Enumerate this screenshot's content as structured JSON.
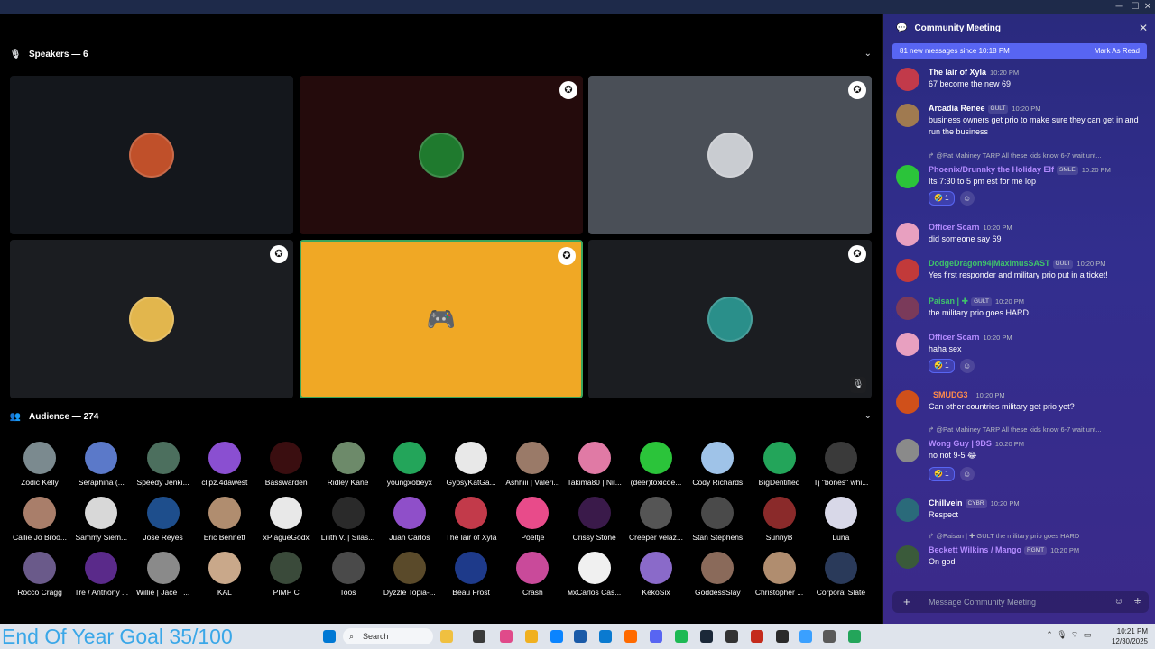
{
  "speakers_header": {
    "label": "Speakers — 6"
  },
  "audience_header": {
    "label": "Audience — 274"
  },
  "speakers": [
    {
      "color": "#14171c",
      "avatar": "#c0502a"
    },
    {
      "color": "#240b0c",
      "avatar": "#1f7a2e"
    },
    {
      "color": "#4a4f57",
      "avatar": "#c9ccd1"
    },
    {
      "color": "#1b1d21",
      "avatar": "#e2b64d"
    },
    {
      "color": "#f0a825",
      "avatar": "#f0a825"
    },
    {
      "color": "#1b1d21",
      "avatar": "#2a8f8a"
    }
  ],
  "audience": [
    {
      "name": "Zodic Kelly",
      "color": "#7b8a8f"
    },
    {
      "name": "Seraphina (...",
      "color": "#5b79c9"
    },
    {
      "name": "Speedy Jenki...",
      "color": "#4c6f5e"
    },
    {
      "name": "clipz.4dawest",
      "color": "#8a4fd1"
    },
    {
      "name": "Basswarden",
      "color": "#3a0e10"
    },
    {
      "name": "Ridley Kane",
      "color": "#6d8a6a"
    },
    {
      "name": "youngxobeyx",
      "color": "#23a55a"
    },
    {
      "name": "GypsyKatGa...",
      "color": "#e8e8e8"
    },
    {
      "name": "Ashhiii | Valeri...",
      "color": "#9a7a68"
    },
    {
      "name": "Takima80 | Nil...",
      "color": "#e07aa5"
    },
    {
      "name": "(deer)toxicde...",
      "color": "#2bc43a"
    },
    {
      "name": "Cody Richards",
      "color": "#9fc3e8"
    },
    {
      "name": "BigDentified",
      "color": "#23a55a"
    },
    {
      "name": "Tj \"bones\" whi...",
      "color": "#3a3a3a"
    },
    {
      "name": "Callie Jo Broo...",
      "color": "#a97e6a"
    },
    {
      "name": "Sammy Siem...",
      "color": "#d8d8d8"
    },
    {
      "name": "Jose Reyes",
      "color": "#1e4e8c"
    },
    {
      "name": "Eric Bennett",
      "color": "#b08d6f"
    },
    {
      "name": "xPlagueGodx",
      "color": "#e8e8e8"
    },
    {
      "name": "Lilith V. | Silas...",
      "color": "#2a2a2a"
    },
    {
      "name": "Juan Carlos",
      "color": "#8f4fc9"
    },
    {
      "name": "The lair of Xyla",
      "color": "#c23a4a"
    },
    {
      "name": "Poeltje",
      "color": "#e84b8a"
    },
    {
      "name": "Crissy Stone",
      "color": "#3a1a4a"
    },
    {
      "name": "Creeper velaz...",
      "color": "#555555"
    },
    {
      "name": "Stan Stephens",
      "color": "#4a4a4a"
    },
    {
      "name": "SunnyB",
      "color": "#8a2a2a"
    },
    {
      "name": "Luna",
      "color": "#d8d8e8"
    },
    {
      "name": "Rocco Cragg",
      "color": "#6a5a8a"
    },
    {
      "name": "Tre / Anthony ...",
      "color": "#5a2a8a"
    },
    {
      "name": "Willie | Jace | ...",
      "color": "#8a8a8a"
    },
    {
      "name": "KAL",
      "color": "#c9a88a"
    },
    {
      "name": "PIMP C",
      "color": "#3a4a3a"
    },
    {
      "name": "Toos",
      "color": "#4a4a4a"
    },
    {
      "name": "Dyzzle Topia-...",
      "color": "#5a4a2a"
    },
    {
      "name": "Beau Frost",
      "color": "#1e3a8a"
    },
    {
      "name": "Crash",
      "color": "#c94a9a"
    },
    {
      "name": "мxCarlos Cas...",
      "color": "#f0f0f0"
    },
    {
      "name": "KekoSix",
      "color": "#8a6ac9"
    },
    {
      "name": "GoddessSlay",
      "color": "#8a6a5a"
    },
    {
      "name": "Christopher ...",
      "color": "#b08d6f"
    },
    {
      "name": "Corporal Slate",
      "color": "#2a3a5a"
    }
  ],
  "goal_text": "End Of Year Goal 35/100",
  "taskbar": {
    "search_label": "Search",
    "time": "10:21 PM",
    "date": "12/30/2025"
  },
  "chat": {
    "title": "Community Meeting",
    "new_messages": "81 new messages since 10:18 PM",
    "mark_read": "Mark As Read",
    "compose_placeholder": "Message Community Meeting",
    "messages": [
      {
        "author": "The lair of Xyla",
        "color": "#ffffff",
        "tags": [],
        "time": "10:20 PM",
        "text": "67 become the new 69",
        "avatar": "#c23a4a"
      },
      {
        "author": "Arcadia Renee",
        "color": "#ffffff",
        "tags": [
          "GULT"
        ],
        "time": "10:20 PM",
        "text": "business owners get prio to make sure they can get in and run the business",
        "avatar": "#a07a50"
      },
      {
        "reply": "@Pat Mahiney  TARP  All these kids know 6-7 wait unt...",
        "author": "Phoenix/Drunnky the Holiday Elf",
        "color": "#b48cff",
        "tags": [
          "SMLE"
        ],
        "time": "10:20 PM",
        "text": "Its 7:30 to 5 pm est for me lop",
        "avatar": "#2bc43a",
        "react": "1"
      },
      {
        "author": "Officer Scarn",
        "color": "#b48cff",
        "tags": [],
        "time": "10:20 PM",
        "text": "did someone say 69",
        "avatar": "#e8a0c0"
      },
      {
        "author": "DodgeDragon94|MaximusSAST",
        "color": "#3fc46a",
        "tags": [
          "GULT"
        ],
        "time": "10:20 PM",
        "text": "Yes first responder and military prio put in a ticket!",
        "avatar": "#c23a3a"
      },
      {
        "author": "Paisan | ✚",
        "color": "#3fc46a",
        "tags": [
          "GULT"
        ],
        "time": "10:20 PM",
        "text": "the military prio goes HARD",
        "avatar": "#7a3a5a"
      },
      {
        "author": "Officer Scarn",
        "color": "#b48cff",
        "tags": [],
        "time": "10:20 PM",
        "text": "haha sex",
        "avatar": "#e8a0c0",
        "react": "1"
      },
      {
        "author": "_SMUDG3_",
        "color": "#ff8a4a",
        "tags": [],
        "time": "10:20 PM",
        "text": "Can other countries military get prio yet?",
        "avatar": "#d0501a"
      },
      {
        "reply": "@Pat Mahiney  TARP  All these kids know 6-7 wait unt...",
        "author": "Wong Guy | 9DS",
        "color": "#b48cff",
        "tags": [],
        "time": "10:20 PM",
        "text": "no not 9-5 😂",
        "avatar": "#8a8a8a",
        "react": "1"
      },
      {
        "author": "Chillvein",
        "color": "#ffffff",
        "tags": [
          "CYBR"
        ],
        "time": "10:20 PM",
        "text": "Respect",
        "avatar": "#2a6a7a"
      },
      {
        "reply": "@Paisan | ✚  GULT  the military prio goes HARD",
        "author": "Beckett Wilkins / Mango",
        "color": "#b48cff",
        "tags": [
          "RGMT"
        ],
        "time": "10:20 PM",
        "text": "On god",
        "avatar": "#3a5a3a"
      }
    ]
  }
}
